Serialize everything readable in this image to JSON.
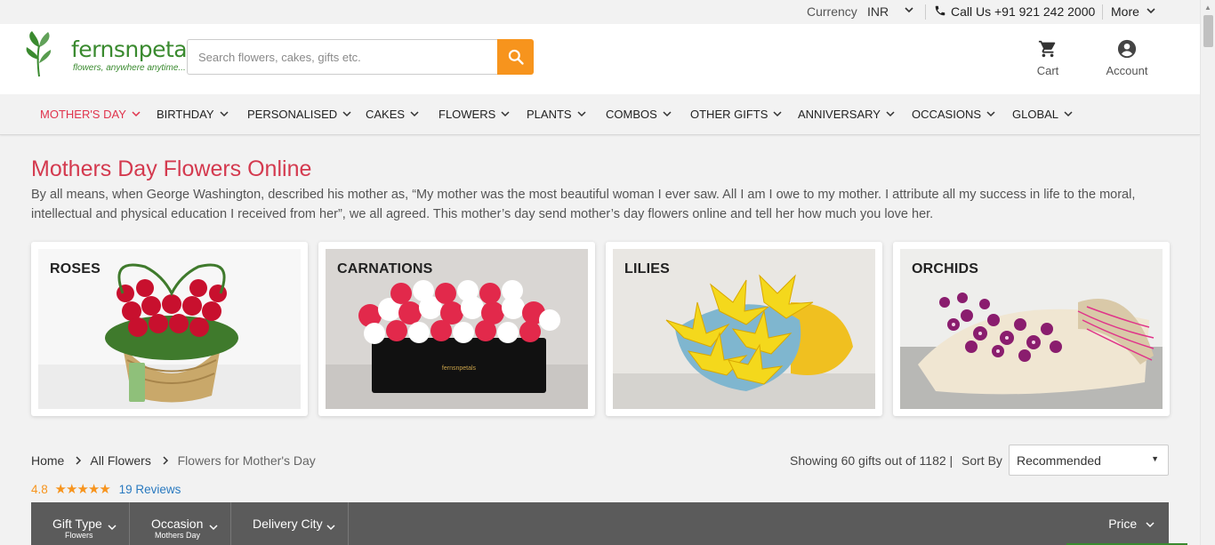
{
  "topbar": {
    "currency_label": "Currency",
    "currency_value": "INR",
    "call_label": "Call Us +91 921 242 2000",
    "more_label": "More"
  },
  "header": {
    "logo_text": "fernsnpetals",
    "logo_tagline": "flowers, anywhere anytime...",
    "search_placeholder": "Search flowers, cakes, gifts etc.",
    "cart_label": "Cart",
    "account_label": "Account"
  },
  "nav": {
    "items": [
      {
        "label": "MOTHER'S DAY"
      },
      {
        "label": "BIRTHDAY"
      },
      {
        "label": "PERSONALISED"
      },
      {
        "label": "CAKES"
      },
      {
        "label": "FLOWERS"
      },
      {
        "label": "PLANTS"
      },
      {
        "label": "COMBOS"
      },
      {
        "label": "OTHER GIFTS"
      },
      {
        "label": "ANNIVERSARY"
      },
      {
        "label": "OCCASIONS"
      },
      {
        "label": "GLOBAL"
      }
    ]
  },
  "main": {
    "title": "Mothers Day Flowers Online",
    "description": "By all means, when George Washington, described his mother as, “My mother was the most beautiful woman I ever saw. All I am I owe to my mother. I attribute all my success in life to the moral, intellectual and physical education I received from her”, we all agreed. This mother’s day send mother’s day flowers online and tell her how much you love her.",
    "categories": [
      {
        "label": "ROSES"
      },
      {
        "label": "CARNATIONS"
      },
      {
        "label": "LILIES"
      },
      {
        "label": "ORCHIDS"
      }
    ],
    "breadcrumb": {
      "home": "Home",
      "all_flowers": "All Flowers",
      "current": "Flowers for Mother's Day"
    },
    "rating": {
      "value": "4.8",
      "stars": "★★★★★",
      "reviews": "19  Reviews"
    },
    "showing": "Showing 60 gifts out of 1182 |",
    "sort_label": "Sort By",
    "sort_value": "Recommended"
  },
  "filters": {
    "items": [
      {
        "label": "Gift Type",
        "sub": "Flowers"
      },
      {
        "label": "Occasion",
        "sub": "Mothers Day"
      },
      {
        "label": "Delivery City",
        "sub": ""
      }
    ],
    "price_label": "Price"
  },
  "colors": {
    "accent": "#e0344d",
    "brand_green": "#3a8a2f",
    "search_button": "#f7941d",
    "filter_bar": "#5b5b5b"
  }
}
